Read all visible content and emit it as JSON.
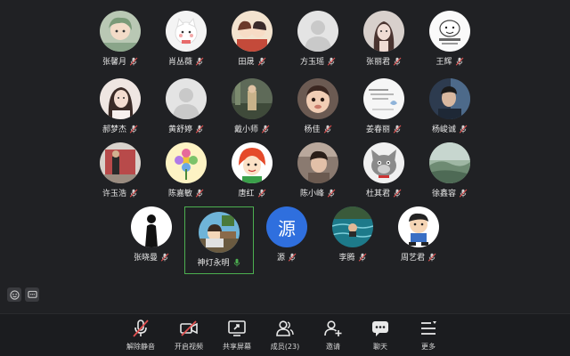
{
  "participants": [
    {
      "name": "张馨月",
      "avatar": "cartoon-girl"
    },
    {
      "name": "肖丛薇",
      "avatar": "white-cat"
    },
    {
      "name": "田晟",
      "avatar": "anime-couple"
    },
    {
      "name": "方玉瑶",
      "avatar": "default-person"
    },
    {
      "name": "张丽君",
      "avatar": "girl-drawing"
    },
    {
      "name": "王辉",
      "avatar": "meme-face"
    },
    {
      "name": "郝梦杰",
      "avatar": "girl-photo"
    },
    {
      "name": "黄舒婷",
      "avatar": "default-person"
    },
    {
      "name": "戴小师",
      "avatar": "outdoor-photo"
    },
    {
      "name": "杨佳",
      "avatar": "baby-photo"
    },
    {
      "name": "姜春丽",
      "avatar": "text-card"
    },
    {
      "name": "杨峻诚",
      "avatar": "man-photo"
    },
    {
      "name": "许玉浩",
      "avatar": "room-photo"
    },
    {
      "name": "陈嘉敏",
      "avatar": "flower-cartoon"
    },
    {
      "name": "唐红",
      "avatar": "redhead-cartoon"
    },
    {
      "name": "陈小峰",
      "avatar": "person-photo"
    },
    {
      "name": "杜其君",
      "avatar": "grey-wolf"
    },
    {
      "name": "徐鑫容",
      "avatar": "landscape"
    },
    {
      "name": "张晓曼",
      "avatar": "silhouette"
    },
    {
      "name": "神灯永明",
      "avatar": "cartoon-scene",
      "speaking": true
    },
    {
      "name": "源",
      "avatar": "letter",
      "letter": "源"
    },
    {
      "name": "李腾",
      "avatar": "pool-photo"
    },
    {
      "name": "周艺君",
      "avatar": "cartoon-boy"
    }
  ],
  "toolbar": {
    "unmute": "解除静音",
    "video": "开启视频",
    "share": "共享屏幕",
    "members": "成员(23)",
    "invite": "邀请",
    "chat": "聊天",
    "more": "更多"
  },
  "colors": {
    "background": "#202124",
    "speaking_border": "#4caf50",
    "muted": "#e05050",
    "letter_avatar": "#2f6fde"
  }
}
